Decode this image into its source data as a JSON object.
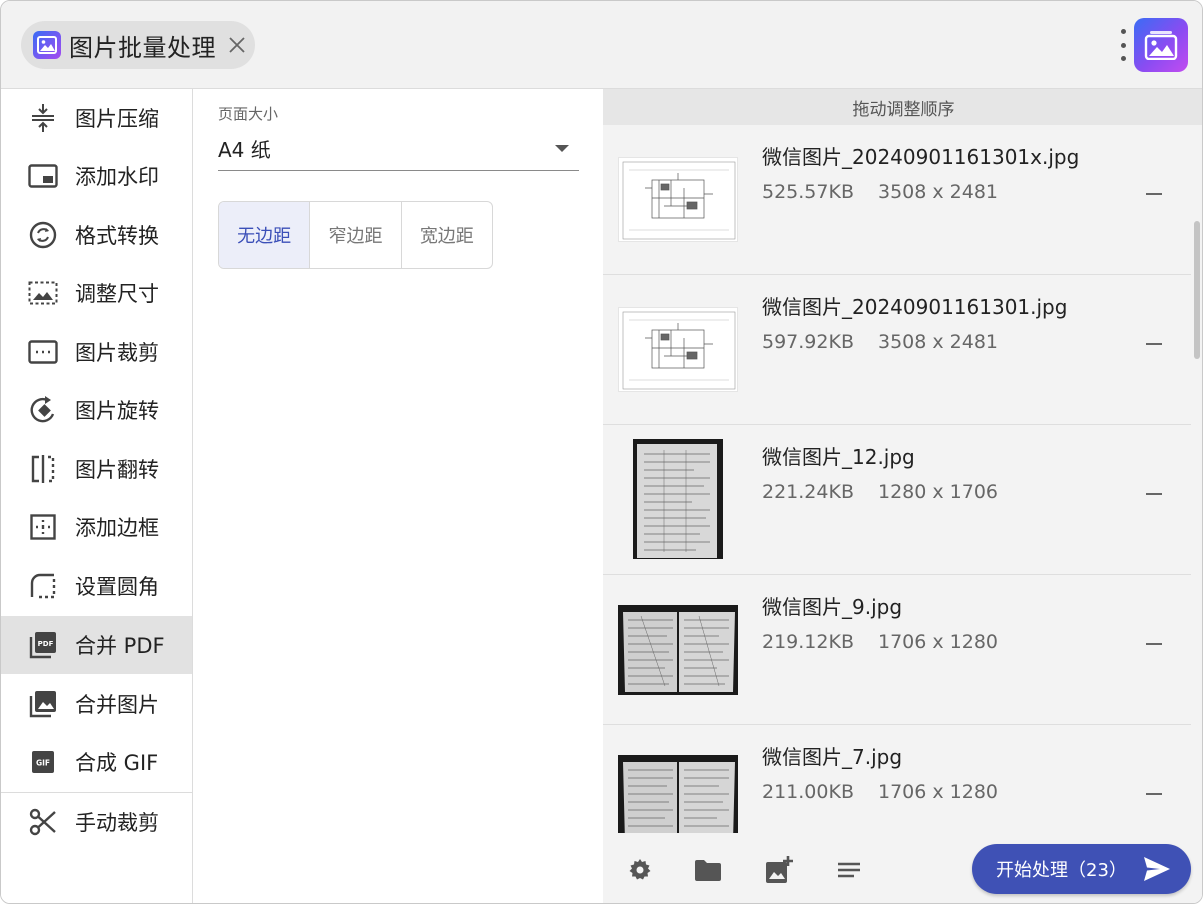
{
  "app": {
    "title": "图片批量处理",
    "accent": "#3f51b5"
  },
  "sidebar": {
    "items": [
      {
        "label": "图片压缩",
        "icon": "compress-icon"
      },
      {
        "label": "添加水印",
        "icon": "watermark-icon"
      },
      {
        "label": "格式转换",
        "icon": "convert-icon"
      },
      {
        "label": "调整尺寸",
        "icon": "resize-icon"
      },
      {
        "label": "图片裁剪",
        "icon": "crop-icon"
      },
      {
        "label": "图片旋转",
        "icon": "rotate-icon"
      },
      {
        "label": "图片翻转",
        "icon": "flip-icon"
      },
      {
        "label": "添加边框",
        "icon": "border-icon"
      },
      {
        "label": "设置圆角",
        "icon": "rounded-corner-icon"
      },
      {
        "label": "合并 PDF",
        "icon": "pdf-icon",
        "active": true
      },
      {
        "label": "合并图片",
        "icon": "merge-images-icon"
      },
      {
        "label": "合成 GIF",
        "icon": "gif-icon"
      },
      {
        "label": "手动裁剪",
        "icon": "scissors-icon"
      }
    ]
  },
  "settings": {
    "page_size_label": "页面大小",
    "page_size_value": "A4 纸",
    "margins": [
      "无边距",
      "窄边距",
      "宽边距"
    ],
    "selected_margin": "无边距"
  },
  "files": {
    "header": "拖动调整顺序",
    "items": [
      {
        "name": "微信图片_20240901161301x.jpg",
        "size": "525.57KB",
        "dims": "3508 x 2481",
        "thumb": "blueprint"
      },
      {
        "name": "微信图片_20240901161301.jpg",
        "size": "597.92KB",
        "dims": "3508 x 2481",
        "thumb": "blueprint"
      },
      {
        "name": "微信图片_12.jpg",
        "size": "221.24KB",
        "dims": "1280 x 1706",
        "thumb": "photo-portrait"
      },
      {
        "name": "微信图片_9.jpg",
        "size": "219.12KB",
        "dims": "1706 x 1280",
        "thumb": "photo-landscape"
      },
      {
        "name": "微信图片_7.jpg",
        "size": "211.00KB",
        "dims": "1706 x 1280",
        "thumb": "photo-landscape"
      }
    ]
  },
  "footer": {
    "start_label": "开始处理（23）",
    "icons": [
      "settings-icon",
      "folder-icon",
      "add-image-icon",
      "sort-icon"
    ]
  }
}
